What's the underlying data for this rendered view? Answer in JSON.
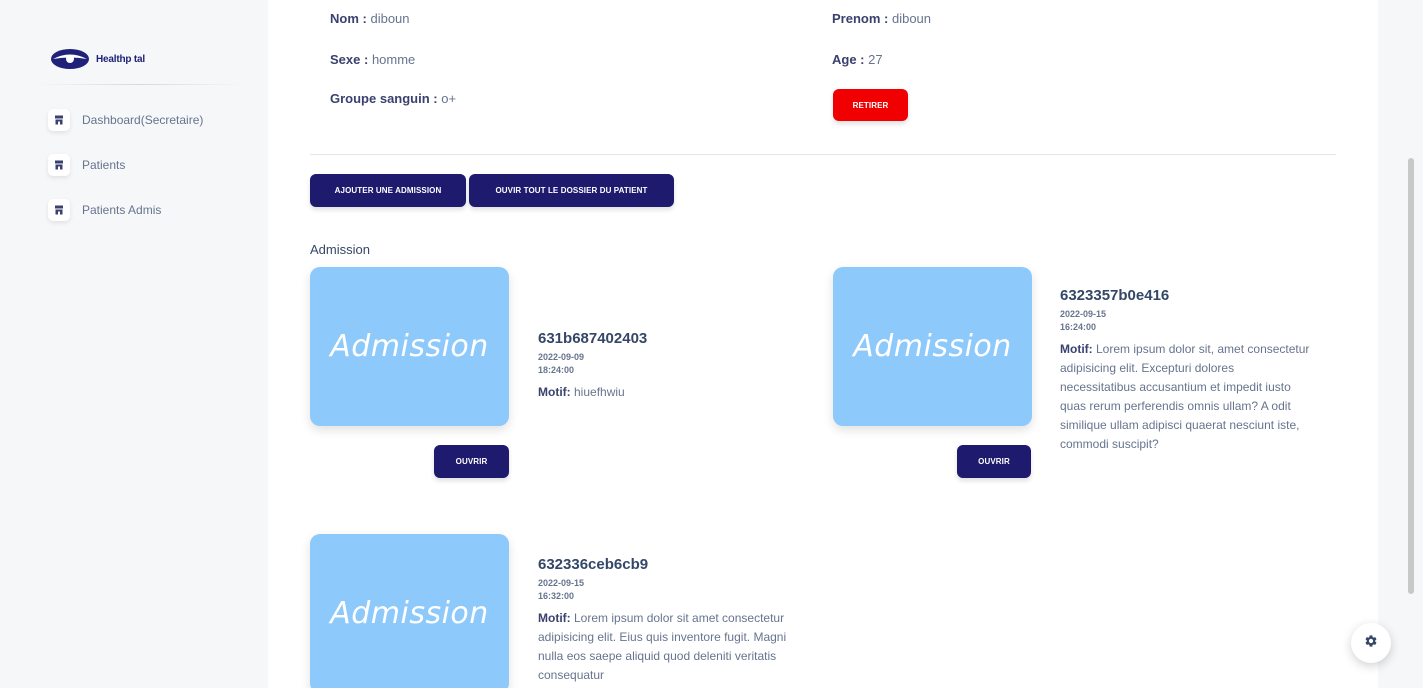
{
  "brand": {
    "logo_text": "Healthp tal"
  },
  "sidebar": {
    "items": [
      {
        "label": "Dashboard(Secretaire)",
        "icon": "store-icon"
      },
      {
        "label": "Patients",
        "icon": "store-icon"
      },
      {
        "label": "Patients Admis",
        "icon": "store-icon"
      }
    ]
  },
  "patient": {
    "nom_label": "Nom :",
    "nom": "diboun",
    "prenom_label": "Prenom :",
    "prenom": "diboun",
    "sexe_label": "Sexe :",
    "sexe": "homme",
    "age_label": "Age :",
    "age": "27",
    "groupe_label": "Groupe sanguin :",
    "groupe": "o+"
  },
  "buttons": {
    "retirer": "RETIRER",
    "ajouter": "AJOUTER UNE ADMISSION",
    "ouvrir_dossier": "OUVIR TOUT LE DOSSIER DU PATIENT",
    "ouvrir": "OUVRIR"
  },
  "section": {
    "title": "Admission"
  },
  "admissions": [
    {
      "image_text": "Admission",
      "id": "631b687402403",
      "date": "2022-09-09",
      "time": "18:24:00",
      "motif_label": "Motif:",
      "motif": "hiuefhwiu"
    },
    {
      "image_text": "Admission",
      "id": "6323357b0e416",
      "date": "2022-09-15",
      "time": "16:24:00",
      "motif_label": "Motif:",
      "motif": "Lorem ipsum dolor sit, amet consectetur adipisicing elit. Excepturi dolores necessitatibus accusantium et impedit iusto quas rerum perferendis omnis ullam? A odit similique ullam adipisci quaerat nesciunt iste, commodi suscipit?"
    },
    {
      "image_text": "Admission",
      "id": "632336ceb6cb9",
      "date": "2022-09-15",
      "time": "16:32:00",
      "motif_label": "Motif:",
      "motif": "Lorem ipsum dolor sit amet consectetur adipisicing elit. Eius quis inventore fugit. Magni nulla eos saepe aliquid quod deleniti veritatis consequatur"
    }
  ],
  "colors": {
    "primary": "#1e1b6e",
    "danger": "#f00000",
    "card": "#8ec9fb",
    "heading": "#344767",
    "text": "#67748e"
  }
}
